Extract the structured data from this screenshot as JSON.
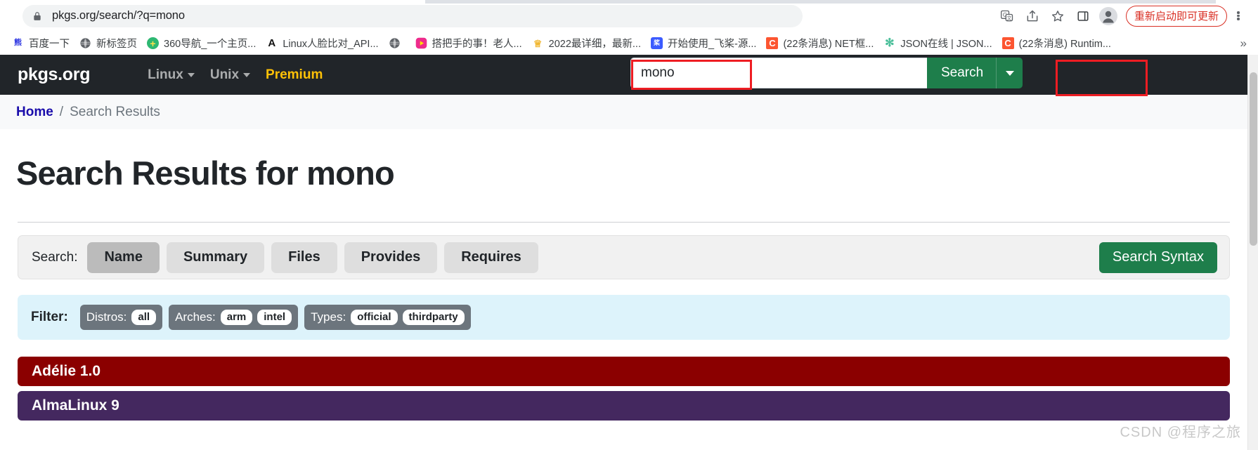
{
  "browser": {
    "url": "pkgs.org/search/?q=mono",
    "lock_icon": "lock-icon",
    "toolbar_icons": [
      {
        "name": "translate-icon",
        "label": "Translate"
      },
      {
        "name": "share-icon",
        "label": "Share"
      },
      {
        "name": "bookmark-star-icon",
        "label": "Bookmark"
      },
      {
        "name": "side-panel-icon",
        "label": "Side panel"
      },
      {
        "name": "profile-avatar-icon",
        "label": "Profile"
      }
    ],
    "update_pill": "重新启动即可更新",
    "menu_icon": "kebab-menu-icon",
    "bookmarks": [
      {
        "label": "百度一下",
        "favicon": "baidu-icon",
        "favicon_text": "百",
        "favicon_bg": "#2932e1",
        "favicon_fg": "#ffffff"
      },
      {
        "label": "新标签页",
        "favicon": "globe-icon",
        "favicon_text": "",
        "favicon_bg": "#6d6d6d",
        "favicon_fg": "#ffffff"
      },
      {
        "label": "360导航_一个主页...",
        "favicon": "360-icon",
        "favicon_text": "+",
        "favicon_bg": "#2eb872",
        "favicon_fg": "#ffe14d"
      },
      {
        "label": "Linux人脸比对_API...",
        "favicon": "a-letter-icon",
        "favicon_text": "A",
        "favicon_bg": "#ffffff",
        "favicon_fg": "#111111"
      },
      {
        "label": "",
        "favicon": "globe-icon",
        "favicon_text": "",
        "favicon_bg": "#6d6d6d",
        "favicon_fg": "#ffffff"
      },
      {
        "label": "搭把手的事！老人...",
        "favicon": "video-play-icon",
        "favicon_text": "▶",
        "favicon_bg": "#ffffff",
        "favicon_fg": "#e8308a"
      },
      {
        "label": "2022最详细，最新...",
        "favicon": "crown-icon",
        "favicon_text": "♕",
        "favicon_bg": "#ffffff",
        "favicon_fg": "#f0b429"
      },
      {
        "label": "开始使用_飞桨-源...",
        "favicon": "paddle-icon",
        "favicon_text": "桨",
        "favicon_bg": "#3b5bff",
        "favicon_fg": "#ffffff"
      },
      {
        "label": "(22条消息) NET框...",
        "favicon": "csdn-icon",
        "favicon_text": "C",
        "favicon_bg": "#fc5531",
        "favicon_fg": "#ffffff"
      },
      {
        "label": "JSON在线 | JSON...",
        "favicon": "gear-icon",
        "favicon_text": "✻",
        "favicon_bg": "#ffffff",
        "favicon_fg": "#4bbf9a"
      },
      {
        "label": "(22条消息) Runtim...",
        "favicon": "csdn-icon",
        "favicon_text": "C",
        "favicon_bg": "#fc5531",
        "favicon_fg": "#ffffff"
      }
    ],
    "bookmarks_overflow": "»"
  },
  "site": {
    "brand": "pkgs.org",
    "nav_links": [
      {
        "label": "Linux",
        "has_caret": true,
        "style": "default"
      },
      {
        "label": "Unix",
        "has_caret": true,
        "style": "default"
      },
      {
        "label": "Premium",
        "has_caret": false,
        "style": "premium"
      }
    ],
    "search": {
      "value": "mono",
      "placeholder": "",
      "submit_label": "Search",
      "dropdown_icon": "chevron-down-icon"
    }
  },
  "breadcrumb": {
    "home": "Home",
    "separator": "/",
    "current": "Search Results"
  },
  "main": {
    "page_title": "Search Results for mono",
    "search_scope": {
      "label": "Search:",
      "tabs": [
        {
          "label": "Name",
          "active": true
        },
        {
          "label": "Summary",
          "active": false
        },
        {
          "label": "Files",
          "active": false
        },
        {
          "label": "Provides",
          "active": false
        },
        {
          "label": "Requires",
          "active": false
        }
      ],
      "syntax_button": "Search Syntax"
    },
    "filter": {
      "label": "Filter:",
      "groups": [
        {
          "name": "Distros:",
          "chips": [
            "all"
          ]
        },
        {
          "name": "Arches:",
          "chips": [
            "arm",
            "intel"
          ]
        },
        {
          "name": "Types:",
          "chips": [
            "official",
            "thirdparty"
          ]
        }
      ]
    },
    "distros": [
      {
        "label": "Adélie 1.0",
        "color": "#8b0000"
      },
      {
        "label": "AlmaLinux 9",
        "color": "#44285f"
      }
    ]
  },
  "watermark": "CSDN @程序之旅",
  "colors": {
    "navbar_bg": "#212529",
    "accent_green": "#1e7e4b",
    "premium_yellow": "#ffc107",
    "filter_bg": "#ddf3fb",
    "annotation_red": "#ee1d23"
  }
}
